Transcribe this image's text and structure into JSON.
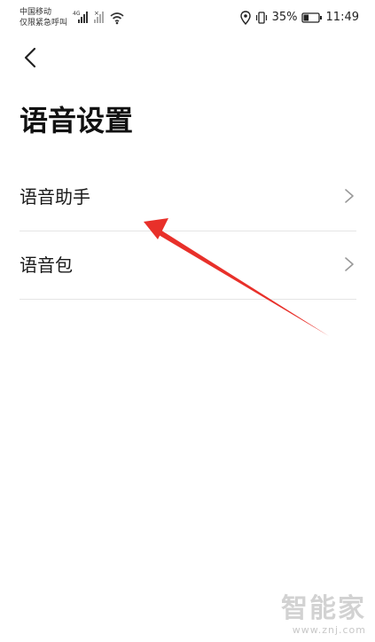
{
  "status_bar": {
    "carrier_line1": "中国移动",
    "carrier_line2": "仅限紧急呼叫",
    "network_label": "4G",
    "battery_percent": "35%",
    "time": "11:49",
    "battery_level": 0.35
  },
  "header": {
    "title": "语音设置"
  },
  "settings": {
    "items": [
      {
        "label": "语音助手"
      },
      {
        "label": "语音包"
      }
    ]
  },
  "annotation": {
    "color": "#e8302a"
  },
  "watermark": {
    "logo": "智能家",
    "url": "www.znj.com"
  }
}
